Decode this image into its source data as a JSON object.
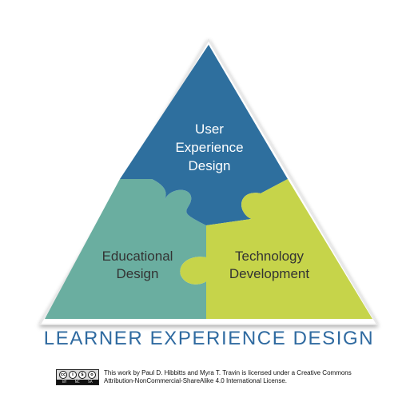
{
  "diagram": {
    "pieces": {
      "ux": {
        "line1": "User",
        "line2": "Experience",
        "line3": "Design",
        "color": "#2e6f9e"
      },
      "edu": {
        "line1": "Educational",
        "line2": "Design",
        "color": "#6aaea0"
      },
      "tech": {
        "line1": "Technology",
        "line2": "Development",
        "color": "#c6d44a"
      }
    },
    "title": "LEARNER EXPERIENCE DESIGN",
    "text_color": "#2f6aa0",
    "label_color": "#333333"
  },
  "license": {
    "badge": {
      "top_symbols": [
        "cc",
        "i",
        "$",
        "o"
      ],
      "bottom_labels": [
        "BY",
        "NC",
        "SA"
      ]
    },
    "line1": "This work by Paul D. Hibbitts and Myra T. Travin is licensed under a Creative Commons",
    "line2": "Attribution-NonCommercial-ShareAlike 4.0 International License."
  }
}
